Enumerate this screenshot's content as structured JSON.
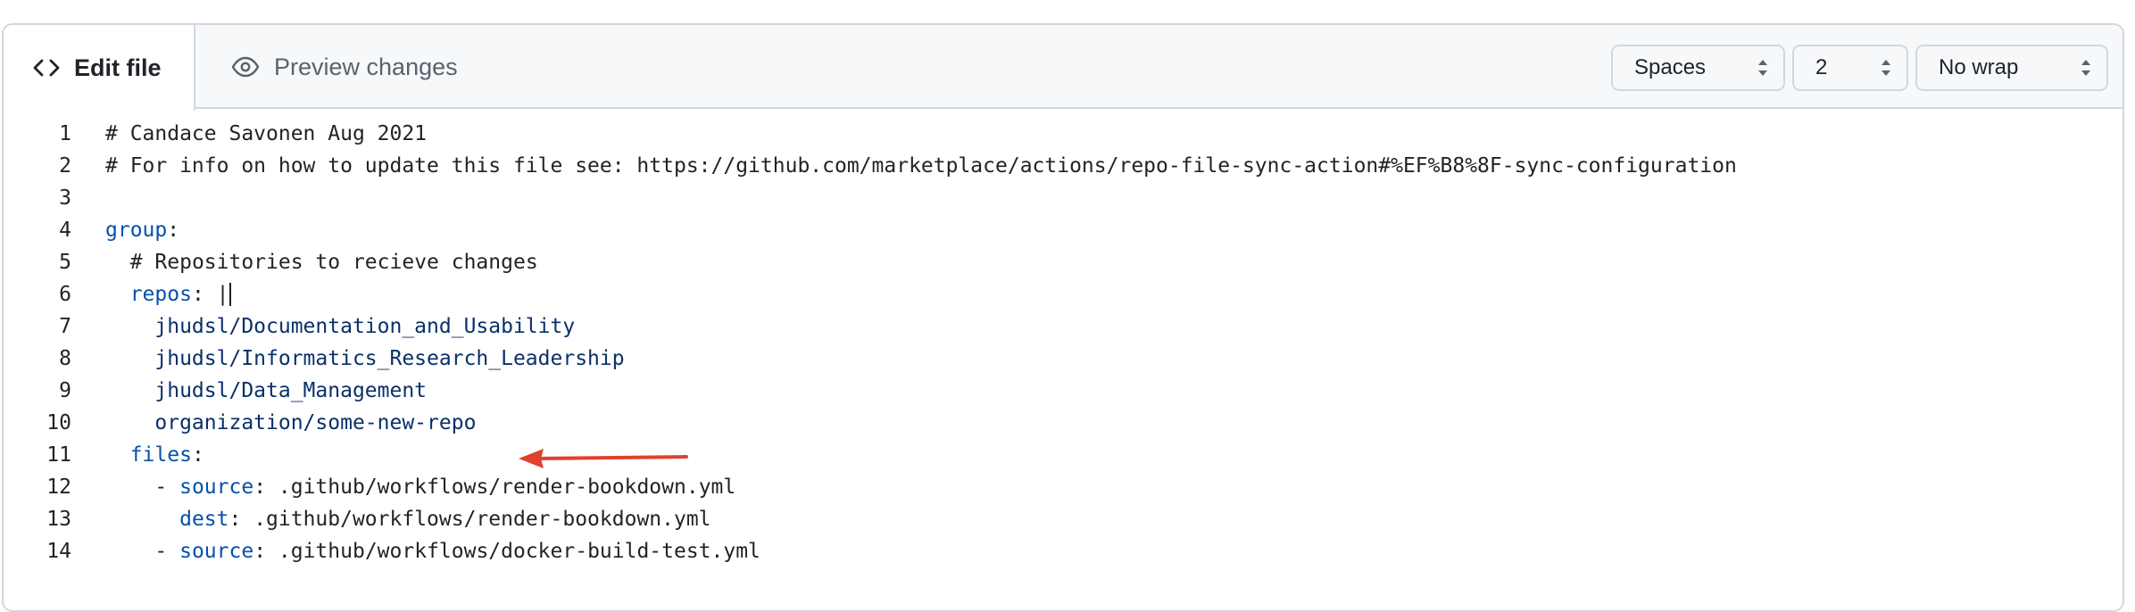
{
  "tabs": {
    "edit_label": "Edit file",
    "preview_label": "Preview changes"
  },
  "controls": {
    "indent_mode": "Spaces",
    "indent_size": "2",
    "wrap_mode": "No wrap"
  },
  "editor": {
    "lines": [
      {
        "num": "1",
        "indent": "",
        "comment": "# Candace Savonen Aug 2021"
      },
      {
        "num": "2",
        "indent": "",
        "comment": "# For info on how to update this file see: https://github.com/marketplace/actions/repo-file-sync-action#%EF%B8%8F-sync-configuration"
      },
      {
        "num": "3"
      },
      {
        "num": "4",
        "indent": "",
        "key": "group",
        "sep": ":"
      },
      {
        "num": "5",
        "indent": "  ",
        "comment": "# Repositories to recieve changes"
      },
      {
        "num": "6",
        "indent": "  ",
        "key": "repos",
        "sep": ": |"
      },
      {
        "num": "7",
        "indent": "    ",
        "value": "jhudsl/Documentation_and_Usability"
      },
      {
        "num": "8",
        "indent": "    ",
        "value": "jhudsl/Informatics_Research_Leadership"
      },
      {
        "num": "9",
        "indent": "    ",
        "value": "jhudsl/Data_Management"
      },
      {
        "num": "10",
        "indent": "    ",
        "value": "organization/some-new-repo"
      },
      {
        "num": "11",
        "indent": "  ",
        "key": "files",
        "sep": ":"
      },
      {
        "num": "12",
        "indent": "    ",
        "dash": "- ",
        "key": "source",
        "sep": ": ",
        "plain": ".github/workflows/render-bookdown.yml"
      },
      {
        "num": "13",
        "indent": "      ",
        "key": "dest",
        "sep": ": ",
        "plain": ".github/workflows/render-bookdown.yml"
      },
      {
        "num": "14",
        "indent": "    ",
        "dash": "- ",
        "key": "source",
        "sep": ": ",
        "plain": ".github/workflows/docker-build-test.yml"
      }
    ]
  },
  "colors": {
    "key": "#0550ae",
    "value": "#0a3069",
    "text": "#1f2328",
    "annotation_arrow": "#e0412d"
  }
}
